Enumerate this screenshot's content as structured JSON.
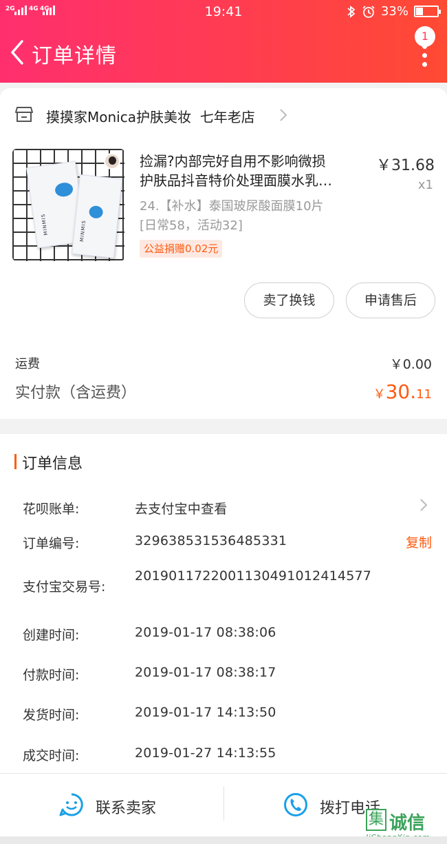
{
  "status_bar": {
    "time": "19:41",
    "battery": "33%",
    "battery_level": 0.33,
    "signal_left": [
      "2G",
      "4G",
      "4G"
    ]
  },
  "nav": {
    "title": "订单详情",
    "notification_count": "1"
  },
  "shop": {
    "name": "摸摸家Monica护肤美妆",
    "tag": "七年老店"
  },
  "item": {
    "title_line1": "捡漏?内部完好自用不影响微损",
    "title_line2": "护肤品抖音特价处理面膜水乳…",
    "price": "￥31.68",
    "quantity": "x1",
    "sku_line1": "24.【补水】泰国玻尿酸面膜10片",
    "sku_line2": "[日常58，活动32]",
    "charity": "公益捐赠0.02元",
    "brand_text": "MINMIS"
  },
  "actions": {
    "sell_label": "卖了换钱",
    "after_sale_label": "申请售后"
  },
  "totals": {
    "shipping_label": "运费",
    "shipping_value": "￥0.00",
    "paid_label": "实付款（含运费）",
    "paid_currency": "￥",
    "paid_integer": "30.",
    "paid_decimal": "11"
  },
  "order_info": {
    "section_title": "订单信息",
    "rows": [
      {
        "label": "花呗账单:",
        "value": "去支付宝中查看"
      },
      {
        "label": "订单编号:",
        "value": "329638531536485331"
      },
      {
        "label": "支付宝交易号:",
        "value": "2019011722001130491012414577"
      },
      {
        "label": "创建时间:",
        "value": "2019-01-17 08:38:06"
      },
      {
        "label": "付款时间:",
        "value": "2019-01-17 08:38:17"
      },
      {
        "label": "发货时间:",
        "value": "2019-01-17 14:13:50"
      },
      {
        "label": "成交时间:",
        "value": "2019-01-27 14:13:55"
      }
    ],
    "copy_label": "复制"
  },
  "bottom_bar": {
    "contact_label": "联系卖家",
    "call_label": "拨打电话"
  },
  "watermark": {
    "box_char": "集",
    "text": "诚信",
    "url": "JiChengXin.com"
  },
  "colors": {
    "header_start": "#ff2f6e",
    "header_end": "#ff4a33",
    "accent_orange": "#ff5a10",
    "icon_blue": "#1aa0e6"
  }
}
